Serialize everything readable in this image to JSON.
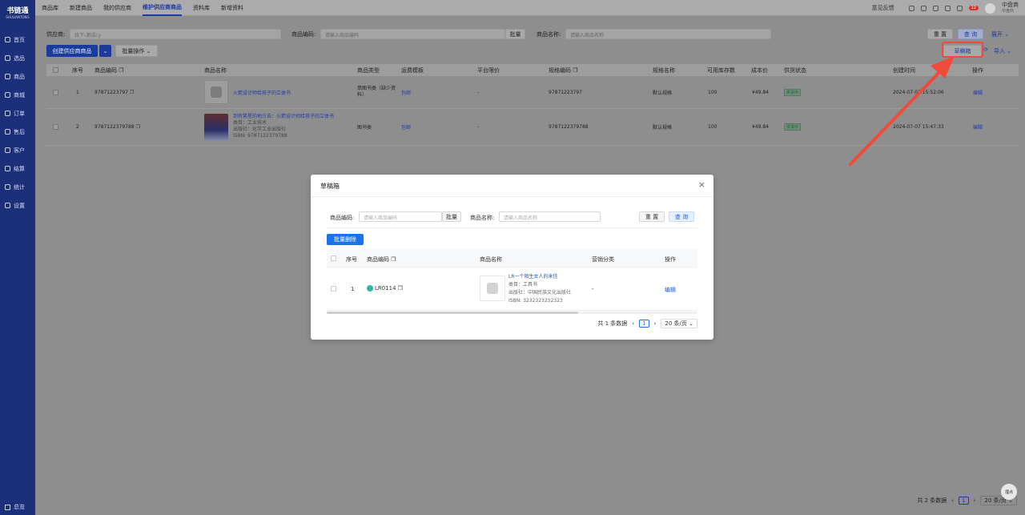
{
  "app": {
    "logo_text": "书链通",
    "logo_sub": "SHULIANTONG"
  },
  "sidebar": {
    "items": [
      {
        "label": "首页",
        "icon": "home-icon"
      },
      {
        "label": "选品",
        "icon": "select-icon"
      },
      {
        "label": "商品",
        "icon": "goods-icon"
      },
      {
        "label": "商城",
        "icon": "mall-icon"
      },
      {
        "label": "订单",
        "icon": "order-icon"
      },
      {
        "label": "售后",
        "icon": "aftersale-icon"
      },
      {
        "label": "客户",
        "icon": "customer-icon"
      },
      {
        "label": "结算",
        "icon": "settle-icon"
      },
      {
        "label": "统计",
        "icon": "stats-icon"
      },
      {
        "label": "设置",
        "icon": "settings-icon"
      }
    ],
    "collapse_label": "总览"
  },
  "topnav": {
    "tabs": [
      "商品库",
      "新建商品",
      "我的供应商",
      "维护供应商商品",
      "资料库",
      "新增资料"
    ],
    "active": "维护供应商商品",
    "feedback": "意见反馈",
    "badge": "12",
    "user_name": "中盘商",
    "user_role": "中盘商"
  },
  "filters": {
    "supplier_label": "供应商:",
    "supplier_value": "线下-测试cy",
    "code_label": "商品编码:",
    "code_placeholder": "请输入商品编码",
    "batch_label": "批量",
    "name_label": "商品名称:",
    "name_placeholder": "请输入商品名称",
    "reset": "重 置",
    "query": "查 询",
    "expand": "展开"
  },
  "actions": {
    "create": "创建供应商商品",
    "batch_ops": "批量操作",
    "draft_box": "草稿箱",
    "import": "导入"
  },
  "table": {
    "headers": [
      "序号",
      "商品编码",
      "商品名称",
      "商品类型",
      "运费模板",
      "平台限价",
      "规格编码",
      "规格名称",
      "可用库存数",
      "成本价",
      "供货状态",
      "创建时间",
      "操作"
    ],
    "rows": [
      {
        "idx": "1",
        "code": "97871223797",
        "name": "火箭设计师给孩子的立体书",
        "meta": [],
        "type": "串图书类（缺少资料）",
        "shipping": "包邮",
        "limit": "-",
        "spec_code": "97871223797",
        "spec_name": "默认规格",
        "stock": "100",
        "cost": "¥49.84",
        "status": "供货中",
        "created": "2024-07-07 15:52:06",
        "action": "编辑"
      },
      {
        "idx": "2",
        "code": "9787122379788",
        "name": "到有繁星的地方去：火箭设计师给孩子的立体书",
        "meta": [
          "类目：工业技术",
          "出版社：化学工业出版社",
          "ISBN: 9787122379788"
        ],
        "type": "图书类",
        "shipping": "包邮",
        "limit": "-",
        "spec_code": "9787122379788",
        "spec_name": "默认规格",
        "stock": "100",
        "cost": "¥49.84",
        "status": "供货中",
        "created": "2024-07-07 15:47:33",
        "action": "编辑"
      }
    ]
  },
  "pagination": {
    "total": "共 2 条数据",
    "page": "1",
    "size": "20 条/页"
  },
  "float_label": "埋点",
  "modal": {
    "title": "草稿箱",
    "code_label": "商品编码:",
    "code_placeholder": "请输入商品编码",
    "batch_label": "批量",
    "name_label": "商品名称:",
    "name_placeholder": "请输入商品名称",
    "reset": "重 置",
    "query": "查 询",
    "batch_delete": "批量删除",
    "headers": [
      "序号",
      "商品编码",
      "商品名称",
      "营销分类",
      "操作"
    ],
    "row": {
      "idx": "1",
      "code": "LR0114",
      "name": "LR一个陌生女人的来信",
      "category": "类目：工具书",
      "publisher": "出版社：中国民族文化出版社",
      "isbn": "ISBN: 3232323232323",
      "marketing": "-",
      "action": "编辑"
    },
    "pagination": {
      "total": "共 1 条数据",
      "page": "1",
      "size": "20 条/页"
    }
  },
  "colors": {
    "sidebar": "#1b2f7a",
    "primary": "#1a73e8",
    "highlight": "#f04a3a"
  }
}
